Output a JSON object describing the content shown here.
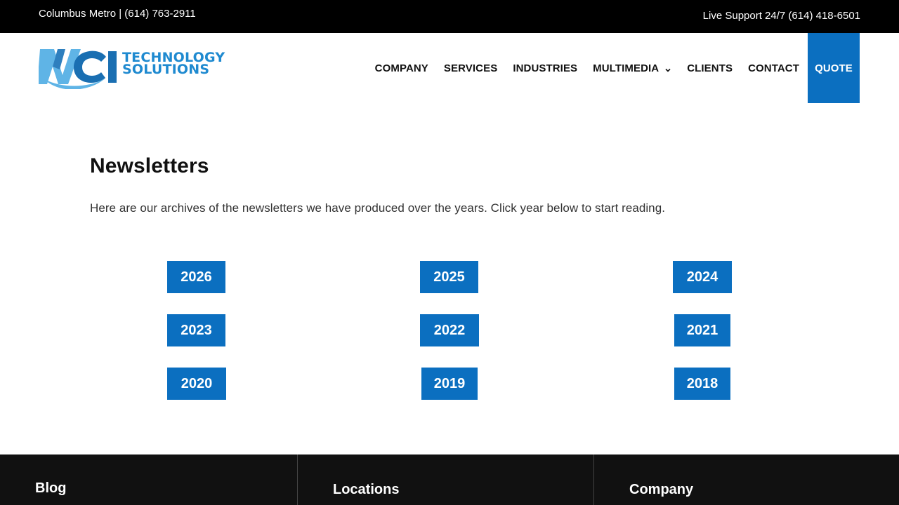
{
  "topbar": {
    "left_text": "Columbus Metro | (614) 763-2911",
    "right_text": "Live Support 24/7 (614) 418-6501"
  },
  "logo": {
    "mark": "WCI",
    "line1": "TECHNOLOGY",
    "line2": "SOLUTIONS",
    "primary_color": "#1f8ad0"
  },
  "nav": {
    "items": [
      {
        "label": "COMPANY"
      },
      {
        "label": "SERVICES"
      },
      {
        "label": "INDUSTRIES"
      },
      {
        "label": "MULTIMEDIA",
        "icon": "chevron-down-icon"
      },
      {
        "label": "CLIENTS"
      },
      {
        "label": "CONTACT"
      }
    ],
    "quote_label": "QUOTE",
    "accent_color": "#0b6fc0"
  },
  "main": {
    "title": "Newsletters",
    "intro": "Here are our archives of the newsletters we have produced over the years. Click year below to start reading.",
    "years": [
      "2026",
      "2025",
      "2024",
      "2023",
      "2022",
      "2021",
      "2020",
      "2019",
      "2018"
    ]
  },
  "footer": {
    "col1_heading": "Blog",
    "col2_heading": "Locations",
    "col3_heading": "Company"
  }
}
